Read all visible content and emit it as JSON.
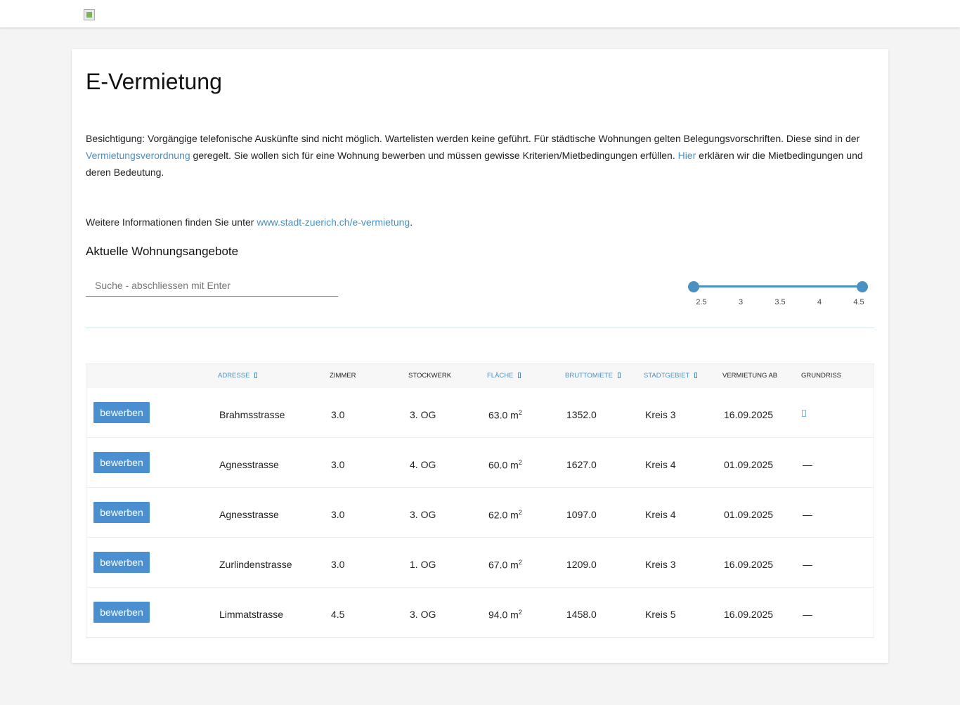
{
  "header": {
    "logo": "stadt-zuerich-logo"
  },
  "page": {
    "title": "E-Vermietung",
    "intro_part1": "Besichtigung: Vorgängige telefonische Auskünfte sind nicht möglich. Wartelisten werden keine geführt. Für städtische Wohnungen gelten Belegungsvorschriften. Diese sind in der ",
    "intro_link1": "Vermietungsverordnung",
    "intro_part2": " geregelt. Sie wollen sich für eine Wohnung bewerben und müssen gewisse Kriterien/Mietbedingungen erfüllen. ",
    "intro_link2": "Hier",
    "intro_part3": " erklären wir die Mietbedingungen und deren Bedeutung.",
    "more_prefix": "Weitere Informationen finden Sie unter ",
    "more_link": "www.stadt-zuerich.ch/e-vermietung",
    "more_suffix": ".",
    "section_title": "Aktuelle Wohnungsangebote"
  },
  "search": {
    "placeholder": "Suche - abschliessen mit Enter",
    "value": ""
  },
  "room_filter": {
    "min": 2.5,
    "max": 4.5,
    "selected_min": 2.5,
    "selected_max": 4.5,
    "ticks": [
      "2.5",
      "3",
      "3.5",
      "4",
      "4.5"
    ]
  },
  "table": {
    "columns": [
      {
        "label": "Adresse",
        "sortable": true
      },
      {
        "label": "Zimmer",
        "sortable": false
      },
      {
        "label": "Stockwerk",
        "sortable": false
      },
      {
        "label": "Fläche",
        "sortable": true
      },
      {
        "label": "Bruttomiete",
        "sortable": true
      },
      {
        "label": "Stadtgebiet",
        "sortable": true
      },
      {
        "label": "Vermietung ab",
        "sortable": false
      },
      {
        "label": "Grundriss",
        "sortable": false
      }
    ],
    "apply_label": "bewerben",
    "area_unit": "m",
    "area_exp": "2",
    "rows": [
      {
        "adresse": "Brahmsstrasse",
        "zimmer": "3.0",
        "stockwerk": "3. OG",
        "flaeche": "63.0",
        "miete": "1352.0",
        "gebiet": "Kreis 3",
        "ab": "16.09.2025",
        "grundriss": "doc"
      },
      {
        "adresse": "Agnesstrasse",
        "zimmer": "3.0",
        "stockwerk": "4. OG",
        "flaeche": "60.0",
        "miete": "1627.0",
        "gebiet": "Kreis 4",
        "ab": "01.09.2025",
        "grundriss": "—"
      },
      {
        "adresse": "Agnesstrasse",
        "zimmer": "3.0",
        "stockwerk": "3. OG",
        "flaeche": "62.0",
        "miete": "1097.0",
        "gebiet": "Kreis 4",
        "ab": "01.09.2025",
        "grundriss": "—"
      },
      {
        "adresse": "Zurlindenstrasse",
        "zimmer": "3.0",
        "stockwerk": "1. OG",
        "flaeche": "67.0",
        "miete": "1209.0",
        "gebiet": "Kreis 3",
        "ab": "16.09.2025",
        "grundriss": "—"
      },
      {
        "adresse": "Limmatstrasse",
        "zimmer": "4.5",
        "stockwerk": "3. OG",
        "flaeche": "94.0",
        "miete": "1458.0",
        "gebiet": "Kreis 5",
        "ab": "16.09.2025",
        "grundriss": "—"
      }
    ]
  }
}
